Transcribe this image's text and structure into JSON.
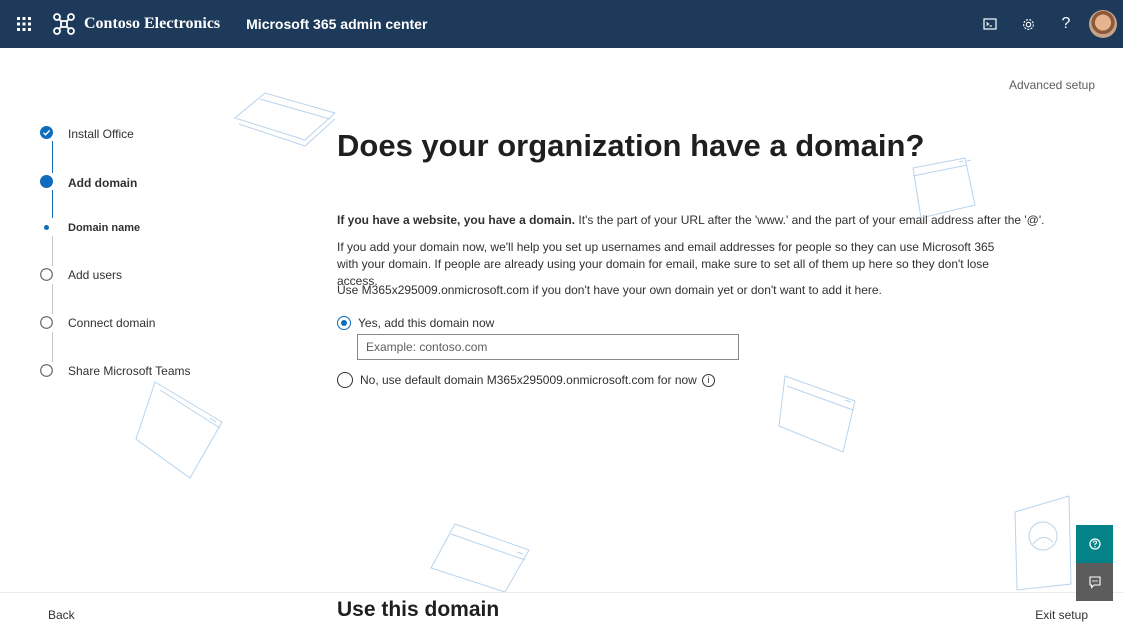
{
  "header": {
    "brand": "Contoso Electronics",
    "app_name": "Microsoft 365 admin center",
    "bg_color": "#1e3a5a",
    "icons": [
      "waffle-icon",
      "terminal-icon",
      "settings-icon",
      "help-icon",
      "avatar"
    ],
    "help_glyph": "?"
  },
  "advanced_setup": "Advanced setup",
  "steps": [
    {
      "label": "Install Office",
      "state": "completed"
    },
    {
      "label": "Add domain",
      "state": "current"
    },
    {
      "label": "Domain name",
      "state": "current-substep"
    },
    {
      "label": "Add users",
      "state": "pending"
    },
    {
      "label": "Connect domain",
      "state": "pending"
    },
    {
      "label": "Share Microsoft Teams",
      "state": "pending"
    }
  ],
  "main": {
    "title": "Does your organization have a domain?",
    "p1_bold": "If you have a website, you have a domain.",
    "p1_rest": " It's the part of your URL after the 'www.' and the part of your email address after the '@'.",
    "p2": "If you add your domain now, we'll help you set up usernames and email addresses for people so they can use Microsoft 365 with your domain. If people are already using your domain for email, make sure to set all of them up here so they don't lose access.",
    "p3": "Use M365x295009.onmicrosoft.com if you don't have your own domain yet or don't want to add it here.",
    "option_yes": "Yes, add this domain now",
    "domain_placeholder": "Example: contoso.com",
    "option_no": "No, use default domain M365x295009.onmicrosoft.com for now",
    "info_glyph": "i"
  },
  "footer": {
    "back": "Back",
    "title": "Use this domain",
    "exit": "Exit setup"
  },
  "colors": {
    "accent": "#0f6cbd",
    "help_button": "#038387",
    "feedback_button": "#5c5c5c"
  }
}
